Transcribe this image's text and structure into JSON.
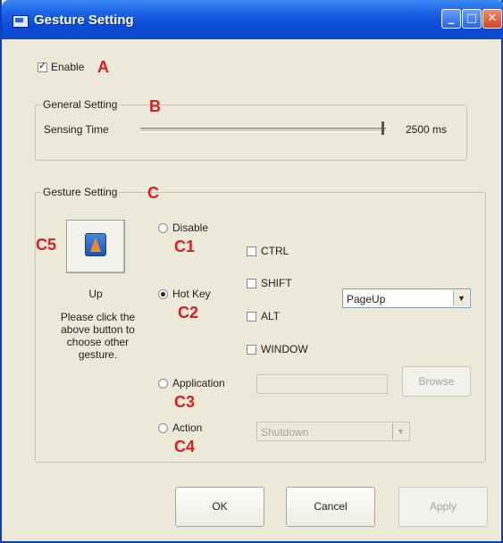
{
  "window": {
    "title": "Gesture Setting"
  },
  "enable": {
    "label": "Enable",
    "checked": true,
    "marker": "A"
  },
  "general_setting": {
    "title": "General Setting",
    "marker": "B",
    "sensing_time_label": "Sensing Time",
    "sensing_time_value": "2500 ms"
  },
  "gesture_setting": {
    "title": "Gesture Setting",
    "marker": "C",
    "gesture_marker": "C5",
    "gesture_name": "Up",
    "help_text": "Please click the above button to choose other gesture.",
    "options": {
      "disable": {
        "label": "Disable",
        "marker": "C1",
        "selected": false
      },
      "hotkey": {
        "label": "Hot Key",
        "marker": "C2",
        "selected": true
      },
      "application": {
        "label": "Application",
        "marker": "C3",
        "selected": false
      },
      "action": {
        "label": "Action",
        "marker": "C4",
        "selected": false
      }
    },
    "modifiers": {
      "ctrl": "CTRL",
      "shift": "SHIFT",
      "alt": "ALT",
      "window": "WINDOW"
    },
    "hotkey_value": "PageUp",
    "browse_label": "Browse",
    "action_value": "Shutdown"
  },
  "footer": {
    "ok": "OK",
    "cancel": "Cancel",
    "apply": "Apply"
  },
  "colors": {
    "titlebar": "#0a4ad6",
    "marker": "#d42020",
    "dialog_bg": "#ece9d8"
  }
}
